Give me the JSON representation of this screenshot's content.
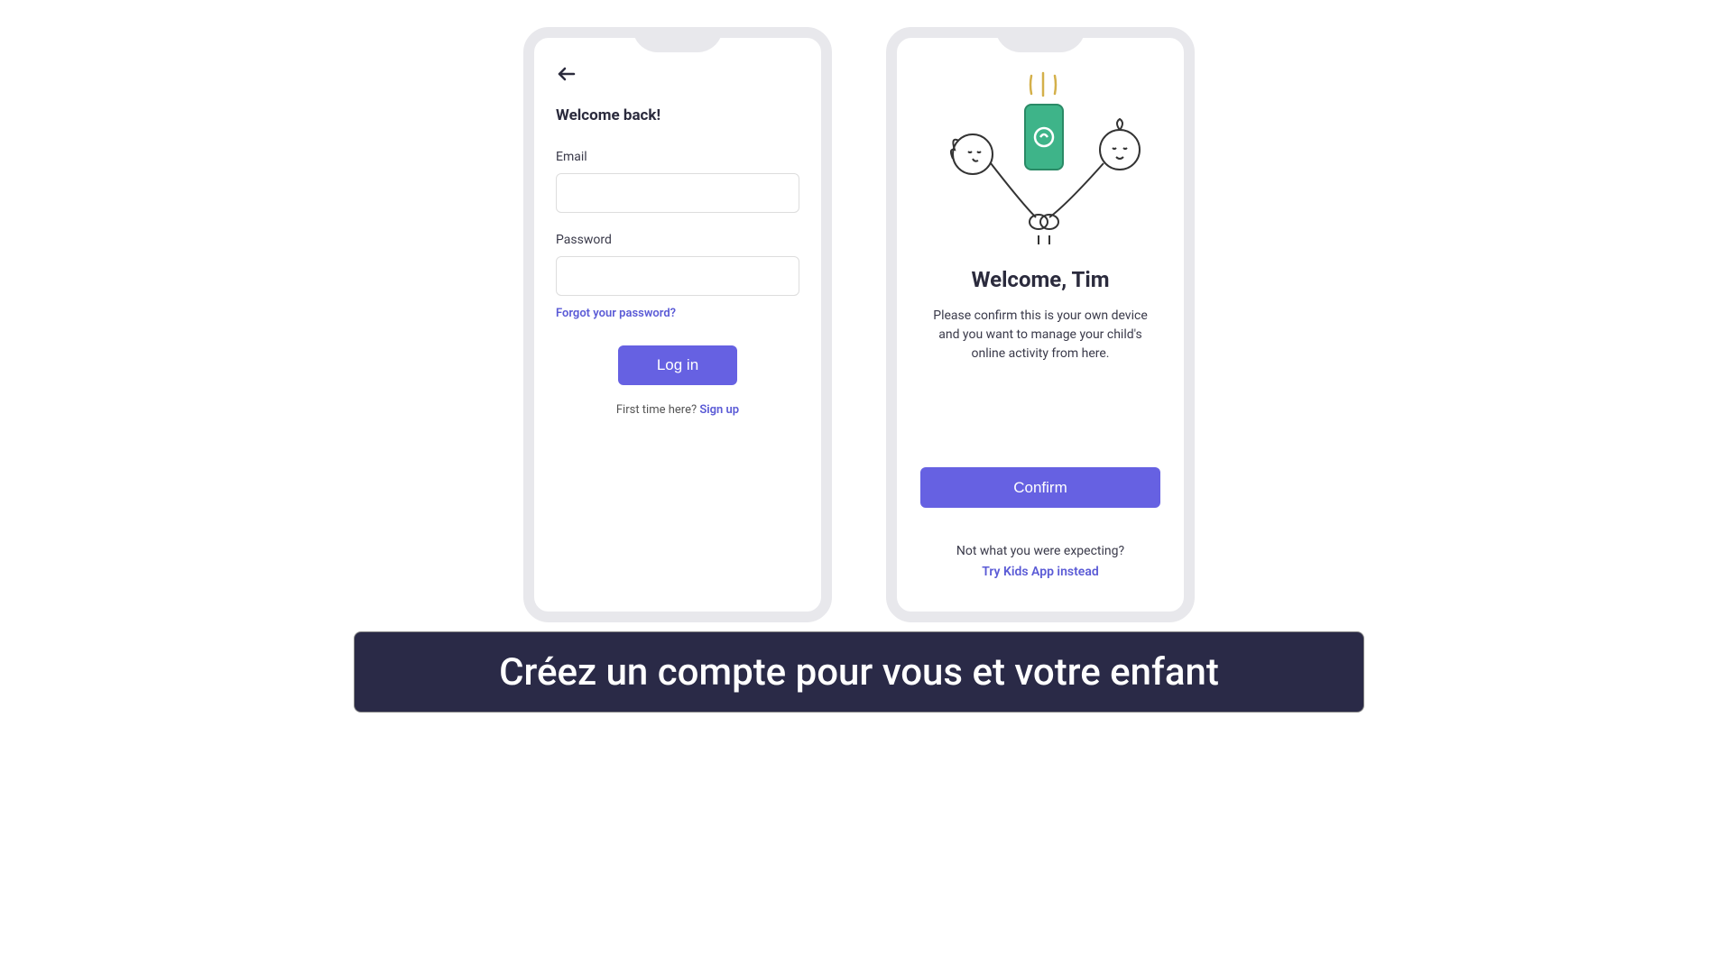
{
  "login": {
    "title": "Welcome back!",
    "email_label": "Email",
    "password_label": "Password",
    "forgot": "Forgot your password?",
    "login_button": "Log in",
    "first_time": "First time here? ",
    "signup": "Sign up"
  },
  "welcome": {
    "heading": "Welcome, Tim",
    "body": "Please confirm this is your own device and you want to manage your child's online activity from here.",
    "confirm_button": "Confirm",
    "not_expecting": "Not what you were expecting?",
    "try_kids": "Try Kids App instead"
  },
  "caption": "Créez un compte pour vous et votre enfant"
}
